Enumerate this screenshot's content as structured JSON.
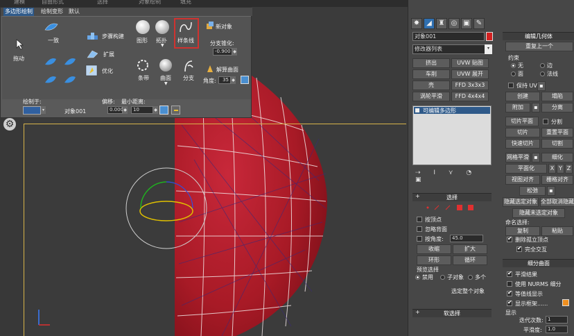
{
  "top_strip": {
    "items": [
      "建模",
      "自由形式",
      "选择",
      "对象绘制",
      "填充"
    ]
  },
  "ribbon": {
    "tabs": [
      "多边形绘制",
      "绘制变形",
      "默认"
    ],
    "drag_label": "拖动",
    "uniform_label": "一致",
    "step_build_label": "步骤构建",
    "extend_label": "扩展",
    "optimize_label": "优化",
    "shape_label": "图形",
    "topology_label": "拓扑",
    "spline_label": "样条线",
    "new_object_label": "新对象",
    "branch_taper_label": "分支锥化:",
    "branch_taper_value": "-0.900",
    "strip_label": "条带",
    "surface_label": "曲面",
    "branch_label": "分支",
    "solve_surface_label": "解算曲面",
    "angle_label": "角度:",
    "angle_value": "35",
    "draw_on_label": "绘制于:",
    "object_name_label": "对象001",
    "offset_label": "偏移:",
    "offset_value": "0.000",
    "min_distance_label": "最小距离:",
    "min_distance_value": "10"
  },
  "command_panel": {
    "object_name": "对象001",
    "object_color": "#d32020",
    "modifier_list": "修改器列表",
    "buttons_left": [
      "挤出",
      "车削",
      "壳",
      "涡轮平滑"
    ],
    "buttons_right": [
      "UVW 贴图",
      "UVW 展开",
      "FFD 3x3x3",
      "FFD 4x4x4"
    ],
    "stack_item": "可编辑多边形",
    "selection": {
      "title": "选择",
      "by_vertex": "按顶点",
      "ignore_backface": "忽略背面",
      "by_angle": "按角度:",
      "angle_value": "45.0",
      "shrink": "收缩",
      "grow": "扩大",
      "ring": "环形",
      "loop": "循环",
      "preview_selection": "预览选择",
      "disabled": "禁用",
      "subobject": "子对象",
      "multi": "多个",
      "select_whole": "选定整个对象"
    },
    "soft_selection": "软选择",
    "edit_geometry": {
      "title": "编辑几何体",
      "repeat_last": "重复上一个",
      "constraints": "约束",
      "none": "无",
      "edge": "边",
      "face": "面",
      "normal": "法线",
      "preserve_uv": "保持 UV",
      "create": "创建",
      "collapse": "塌陷",
      "attach": "附加",
      "detach": "分离",
      "slice_plane": "切片平面",
      "split": "分割",
      "slice": "切片",
      "reset_plane": "重置平面",
      "quickslice": "快速切片",
      "cut": "切割",
      "meshsmooth": "网格平滑",
      "tessellate": "细化",
      "make_planar": "平面化",
      "x": "X",
      "y": "Y",
      "z": "Z",
      "view_align": "视图对齐",
      "grid_align": "栅格对齐",
      "relax": "松弛",
      "hide_selected": "隐藏选定对象",
      "unhide_all": "全部取消隐藏",
      "hide_unselected": "隐藏未选定对象",
      "named_selection": "命名选择:",
      "copy": "复制",
      "paste": "粘贴",
      "delete_isolated": "删除孤立顶点",
      "full_interactivity": "完全交互"
    },
    "subdivision": {
      "title": "细分曲面",
      "smooth_result": "平滑结果",
      "use_nurms": "使用 NURMS 细分",
      "isoline": "等值线显示",
      "show_cage": "显示框架......",
      "display": "显示",
      "iterations_label": "迭代次数:",
      "iterations_value": "1",
      "smoothness_label": "平滑度:",
      "smoothness_value": "1.0"
    }
  }
}
